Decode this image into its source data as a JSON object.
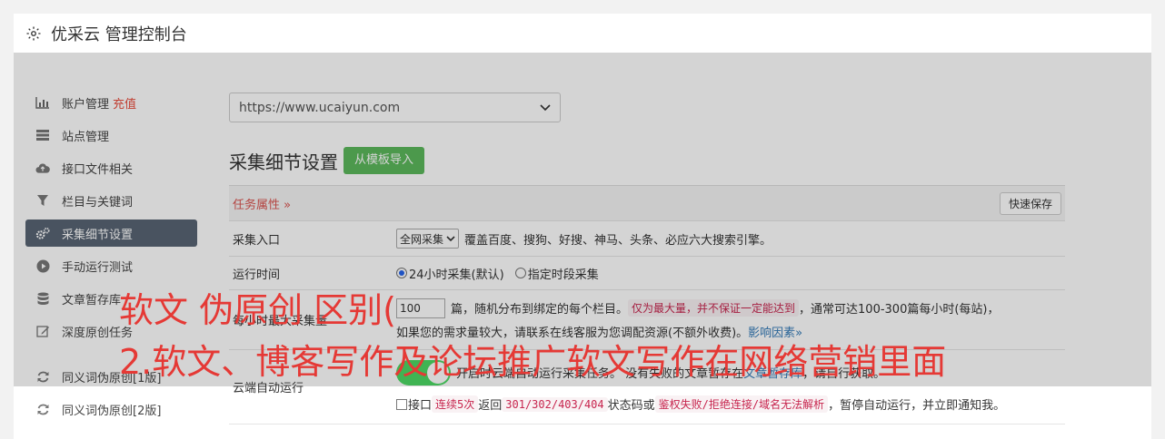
{
  "header": {
    "title": "优采云 管理控制台",
    "icon": "gear-icon"
  },
  "sidebar": {
    "items": [
      {
        "label": "账户管理",
        "extra": "充值",
        "icon": "bar-chart-icon"
      },
      {
        "label": "站点管理",
        "icon": "server-icon"
      },
      {
        "label": "接口文件相关",
        "icon": "cloud-upload-icon"
      },
      {
        "label": "栏目与关键词",
        "icon": "filter-icon"
      },
      {
        "label": "采集细节设置",
        "icon": "cogs-icon",
        "active": true
      },
      {
        "label": "手动运行测试",
        "icon": "play-circle-icon"
      },
      {
        "label": "文章暂存库",
        "icon": "database-icon"
      },
      {
        "label": "深度原创任务",
        "icon": "edit-icon"
      },
      {
        "label": "同义词伪原创[1版]",
        "icon": "refresh-icon"
      },
      {
        "label": "同义词伪原创[2版]",
        "icon": "refresh-icon"
      }
    ]
  },
  "main": {
    "site_select": "https://www.ucaiyun.com",
    "section_title": "采集细节设置",
    "import_button": "从模板导入",
    "task_attr": "任务属性 »",
    "quick_save": "快速保存",
    "rows": {
      "entry": {
        "label": "采集入口",
        "select": "全网采集",
        "desc": "覆盖百度、搜狗、好搜、神马、头条、必应六大搜索引擎。"
      },
      "runtime": {
        "label": "运行时间",
        "opt1": "24小时采集(默认)",
        "opt2": "指定时段采集"
      },
      "max": {
        "label": "每小时最大采集量",
        "value": "100",
        "text1": "篇，随机分布到绑定的每个栏目。",
        "code1": "仅为最大量，并不保证一定能达到",
        "text2": "，通常可达100-300篇每小时(每站)，",
        "text3": "如果您的需求量较大，请联系在线客服为您调配资源(不额外收费)。",
        "link": "影响因素»"
      },
      "cloud": {
        "label": "云端自动运行",
        "text_a": "开启时云端自动运行采集任务。 没有失败的文章暂存在",
        "link": "文章暂存库",
        "text_b": "，请自行获取。",
        "chk": "接口",
        "code1": "连续5次",
        "t1": "返回",
        "code2": "301/302/403/404",
        "t2": "状态码或",
        "code3": "鉴权失败/拒绝连接/域名无法解析",
        "t3": "，暂停自动运行，并立即通知我。"
      }
    }
  },
  "watermark": {
    "line1": "软文 伪原创 区别(",
    "line2": "2.软文、博客写作及论坛推广软文写作在网络营销里面"
  }
}
